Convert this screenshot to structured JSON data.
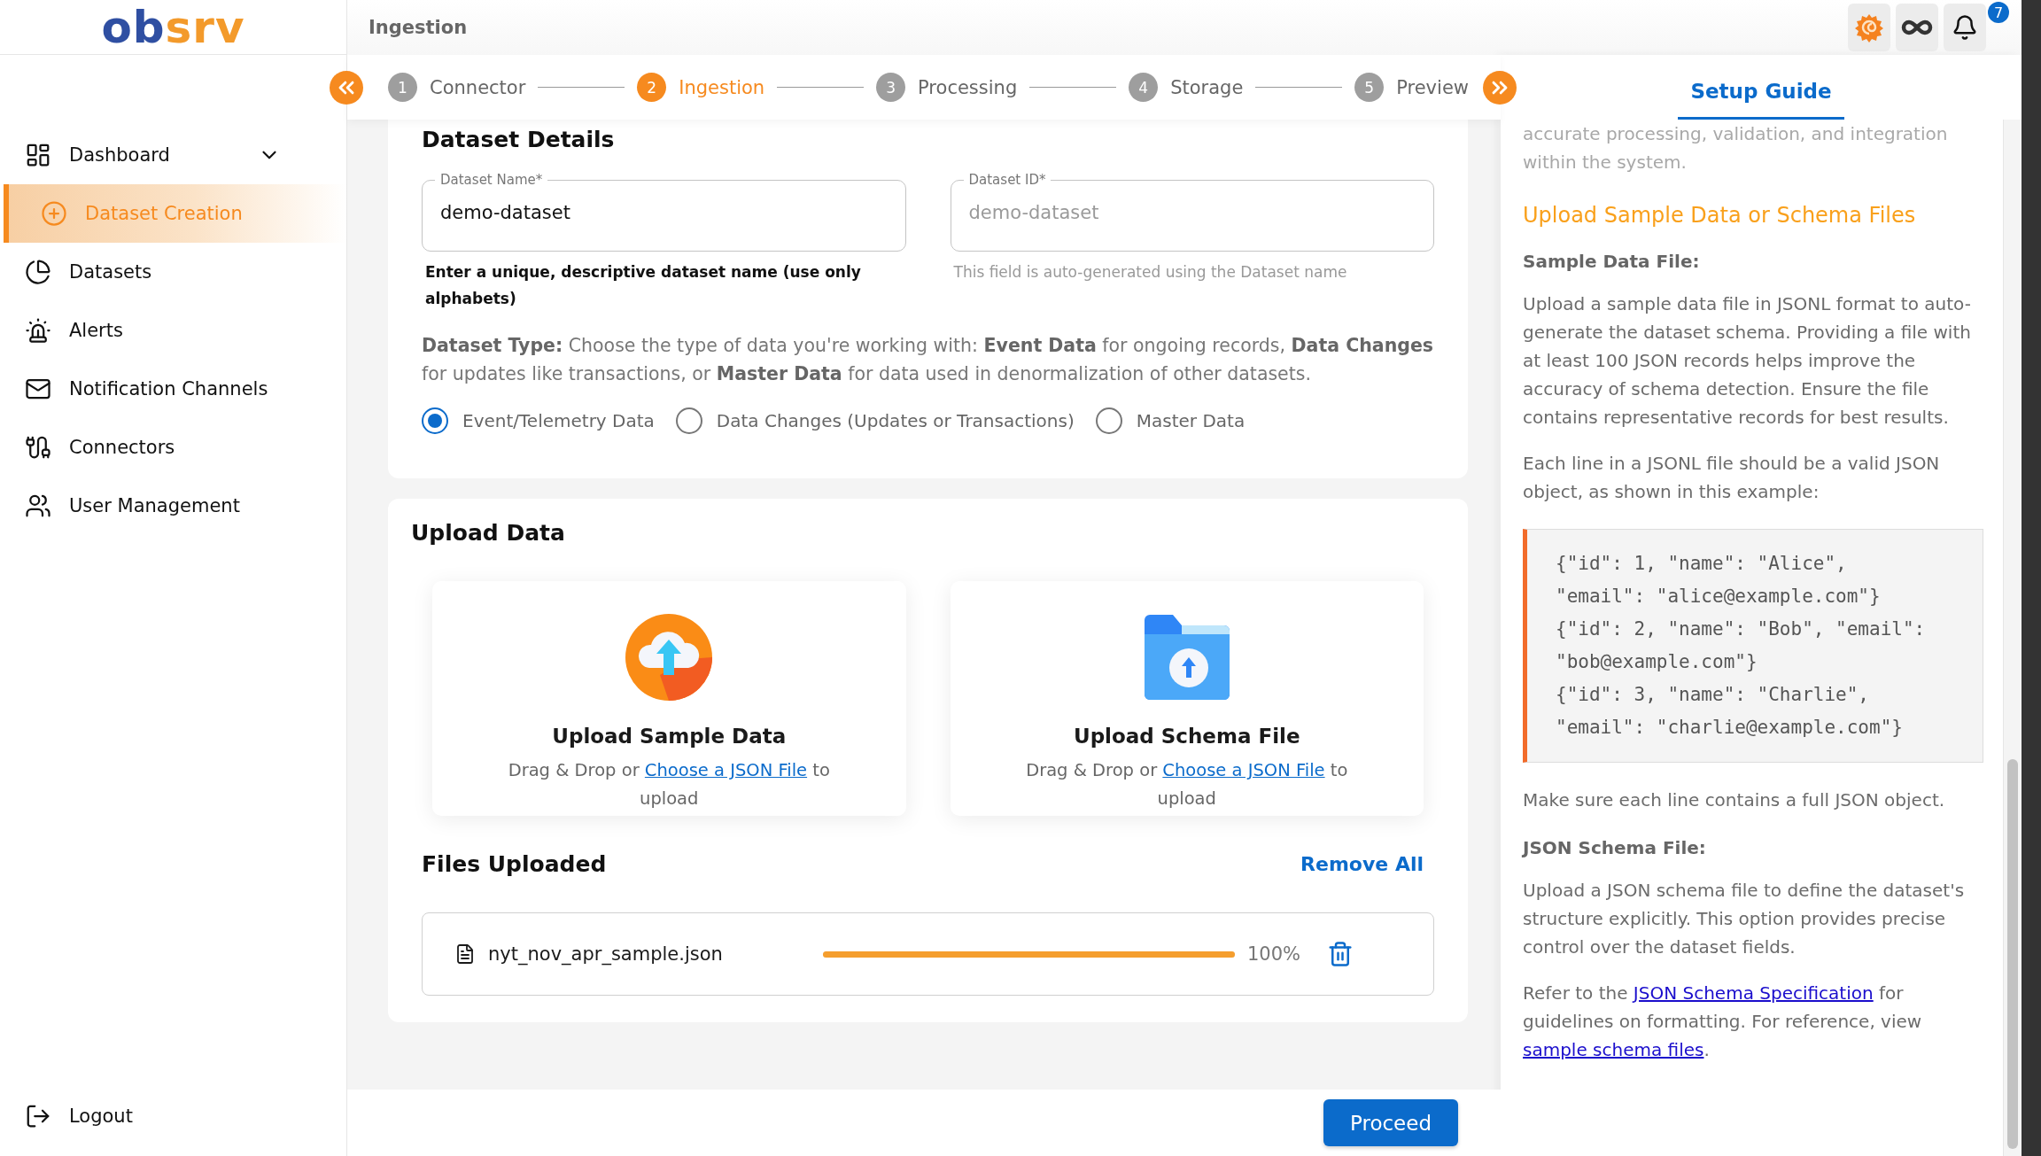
{
  "logo": "obsrv",
  "header": {
    "title": "Ingestion",
    "notification_count": "7"
  },
  "sidebar": {
    "items": [
      {
        "label": "Dashboard",
        "kind": "group",
        "selected": false
      },
      {
        "label": "Dataset Creation",
        "kind": "create",
        "selected": true
      },
      {
        "label": "Datasets",
        "kind": "datasets",
        "selected": false
      },
      {
        "label": "Alerts",
        "kind": "alerts",
        "selected": false
      },
      {
        "label": "Notification Channels",
        "kind": "mail",
        "selected": false
      },
      {
        "label": "Connectors",
        "kind": "connectors",
        "selected": false
      },
      {
        "label": "User Management",
        "kind": "users",
        "selected": false
      }
    ],
    "logout": "Logout"
  },
  "stepper": [
    {
      "number": "1",
      "label": "Connector",
      "selected": false
    },
    {
      "number": "2",
      "label": "Ingestion",
      "selected": true
    },
    {
      "number": "3",
      "label": "Processing",
      "selected": false
    },
    {
      "number": "4",
      "label": "Storage",
      "selected": false
    },
    {
      "number": "5",
      "label": "Preview",
      "selected": false
    }
  ],
  "dataset_details": {
    "title": "Dataset Details",
    "fields": [
      {
        "label": "Dataset Name*",
        "value": "demo-dataset",
        "helper": "Enter a unique, descriptive dataset name (use only alphabets)",
        "disabled": false
      },
      {
        "label": "Dataset ID*",
        "value": "demo-dataset",
        "helper": "This field is auto-generated using the Dataset name",
        "disabled": true
      }
    ],
    "type_description": "**Dataset Type:** Choose the type of data you're working with: **Event Data** for ongoing records, **Data Changes** for updates like transactions, or **Master Data** for data used in denormalization of other datasets.",
    "options": [
      {
        "label": "Event/Telemetry Data",
        "selected": true
      },
      {
        "label": "Data Changes (Updates or Transactions)",
        "selected": false
      },
      {
        "label": "Master Data",
        "selected": false
      }
    ]
  },
  "upload": {
    "title": "Upload Data",
    "cards": [
      {
        "kind": "sample",
        "title": "Upload Sample Data",
        "before": "Drag & Drop or",
        "link": "Choose a JSON File",
        "after": "to upload"
      },
      {
        "kind": "schema",
        "title": "Upload Schema File",
        "before": "Drag & Drop or",
        "link": "Choose a JSON File",
        "after": "to upload"
      }
    ],
    "files_title": "Files Uploaded",
    "remove_all": "Remove All",
    "files": [
      {
        "name": "nyt_nov_apr_sample.json",
        "level": 1,
        "reading": "100%"
      }
    ]
  },
  "footer": {
    "proceed": "Proceed"
  },
  "guide": {
    "tabs": [
      {
        "label": "Setup Guide",
        "selected": true
      }
    ],
    "blocks": [
      {
        "kind": "faded",
        "text": "accurate processing, validation, and integration within the system."
      },
      {
        "kind": "heading",
        "text": "Upload Sample Data or Schema Files"
      },
      {
        "kind": "subheading",
        "text": "Sample Data File:"
      },
      {
        "kind": "paragraph",
        "text": "Upload a sample data file in JSONL format to auto-generate the dataset schema. Providing a file with at least 100 JSON records helps improve the accuracy of schema detection. Ensure the file contains representative records for best results."
      },
      {
        "kind": "paragraph",
        "text": "Each line in a JSONL file should be a valid JSON object, as shown in this example:"
      },
      {
        "kind": "code",
        "lines": [
          "{\"id\": 1, \"name\": \"Alice\", \"email\": \"alice@example.com\"}",
          "{\"id\": 2, \"name\": \"Bob\", \"email\": \"bob@example.com\"}",
          "{\"id\": 3, \"name\": \"Charlie\", \"email\": \"charlie@example.com\"}"
        ]
      },
      {
        "kind": "paragraph",
        "text": "Make sure each line contains a full JSON object."
      },
      {
        "kind": "subheading",
        "text": "JSON Schema File:"
      },
      {
        "kind": "paragraph",
        "text": "Upload a JSON schema file to define the dataset's structure explicitly. This option provides precise control over the dataset fields."
      },
      {
        "kind": "links",
        "parts": [
          {
            "text": "Refer to the "
          },
          {
            "link": "JSON Schema Specification"
          },
          {
            "text": " for guidelines on formatting. For reference, view "
          },
          {
            "link": "sample schema files"
          },
          {
            "text": "."
          }
        ]
      }
    ]
  }
}
